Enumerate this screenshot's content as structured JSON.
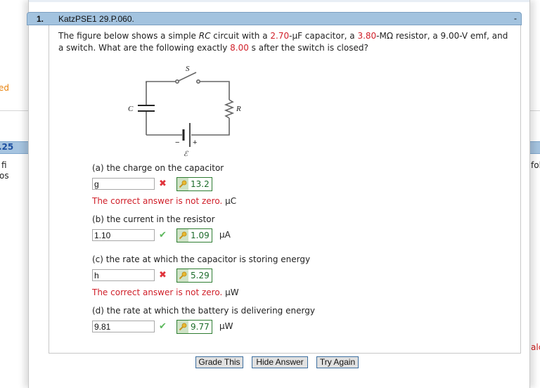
{
  "background": {
    "left_fragments": [
      "ed",
      ".25",
      "fi",
      "os"
    ],
    "right_fragments": [
      "fol",
      "alc"
    ]
  },
  "question": {
    "number": "1.",
    "title": "KatzPSE1 29.P.060.",
    "collapse_label": "-",
    "text": {
      "p1": "The figure below shows a simple ",
      "rc": "RC",
      "p2": " circuit with a ",
      "capacitance": "2.70",
      "p3": "-µF capacitor, a ",
      "resistance": "3.80",
      "p4": "-MΩ resistor, a 9.00-V emf, and a switch. What are the following exactly ",
      "time": "8.00",
      "p5": " s after the switch is closed?"
    },
    "figure": {
      "labels": {
        "switch": "S",
        "capacitor": "C",
        "resistor": "R",
        "emf": "ℰ",
        "minus": "−",
        "plus": "+"
      }
    },
    "parts": [
      {
        "label": "(a) the charge on the capacitor",
        "input_value": "g",
        "status": "incorrect",
        "status_icon": "x-mark-icon",
        "correct_answer": "13.2",
        "unit": "",
        "feedback": "The correct answer is not zero.",
        "feedback_unit": "µC"
      },
      {
        "label": "(b) the current in the resistor",
        "input_value": "1.10",
        "status": "correct",
        "status_icon": "check-mark-icon",
        "correct_answer": "1.09",
        "unit": "µA"
      },
      {
        "label": "(c) the rate at which the capacitor is storing energy",
        "input_value": "h",
        "status": "incorrect",
        "status_icon": "x-mark-icon",
        "correct_answer": "5.29",
        "unit": "",
        "feedback": "The correct answer is not zero.",
        "feedback_unit": "µW"
      },
      {
        "label": "(d) the rate at which the battery is delivering energy",
        "input_value": "9.81",
        "status": "correct",
        "status_icon": "check-mark-icon",
        "correct_answer": "9.77",
        "unit": "µW"
      }
    ],
    "buttons": {
      "grade": "Grade This",
      "hide_answer": "Hide Answer",
      "try_again": "Try Again"
    },
    "symbols": {
      "x_mark": "✖",
      "check_mark": "✔"
    }
  },
  "colors": {
    "header_blue": "#a3c3df",
    "value_red": "#d0202a",
    "correct_green": "#1c6b2a",
    "check_green": "#5cb85c",
    "x_red": "#e0343c"
  }
}
